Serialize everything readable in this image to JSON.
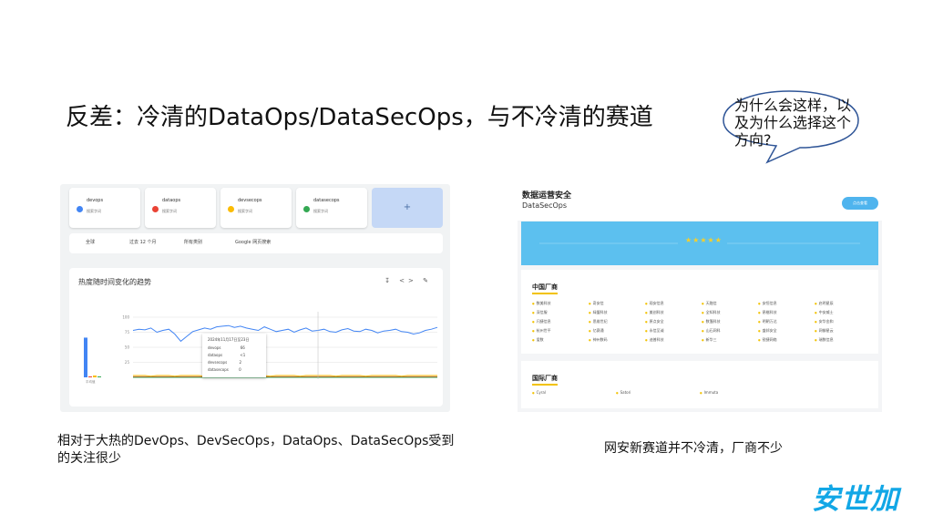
{
  "slide": {
    "title": "反差：冷清的DataOps/DataSecOps，与不冷清的赛道",
    "bubble_text": "为什么会这样，以及为什么选择这个方向?",
    "caption_left": "相对于大热的DevOps、DevSecOps，DataOps、DataSecOps受到的关注很少",
    "caption_right": "网安新赛道并不冷清，厂商不少",
    "logo": "安世加"
  },
  "colors": {
    "accent": "#12a7e6",
    "series_devops": "#4285f4",
    "series_dataops": "#ea4335",
    "series_devsecops": "#fbbc04",
    "series_datasecops": "#34a853"
  },
  "trends": {
    "terms": [
      {
        "name": "devops",
        "sub": "搜索字词"
      },
      {
        "name": "dataops",
        "sub": "搜索字词"
      },
      {
        "name": "devsecops",
        "sub": "搜索字词"
      },
      {
        "name": "datasecops",
        "sub": "搜索字词"
      }
    ],
    "add_label": "+",
    "filters": [
      "全球",
      "过去 12 个月",
      "所有类别",
      "Google 网页搜索"
    ],
    "chart_title": "热度随时间变化的趋势",
    "tooltip_date": "2024年11月17日至23日",
    "tooltip_rows": [
      {
        "term": "devops",
        "value": "66"
      },
      {
        "term": "dataops",
        "value": "<1"
      },
      {
        "term": "devsecops",
        "value": "2"
      },
      {
        "term": "datasecops",
        "value": "0"
      }
    ],
    "avg_label": "平均值"
  },
  "vendor": {
    "title": "数据运营安全",
    "subtitle": "DataSecOps",
    "button": "点击查看",
    "stars": "★★★★★",
    "china_title": "中国厂商",
    "china_vendors": [
      "数美科技",
      "奇安信",
      "观安信息",
      "天融信",
      "安恒信息",
      "启明星辰",
      "深信服",
      "绿盟科技",
      "美创科技",
      "全知科技",
      "昂楷科技",
      "中安威士",
      "闪捷信息",
      "思维世纪",
      "原点安全",
      "数篷科技",
      "明朝万达",
      "安华金和",
      "杭州世平",
      "亿赛通",
      "永信至诚",
      "山石网科",
      "盛邦安全",
      "网御星云",
      "爱数",
      "神州数码",
      "迪普科技",
      "新华三",
      "锐捷网络",
      "瑞数信息"
    ],
    "intl_title": "国际厂商",
    "intl_vendors": [
      "Cyral",
      "Satori",
      "Immuta"
    ]
  },
  "chart_data": {
    "type": "line",
    "x_points": 52,
    "series": [
      {
        "name": "devops",
        "values": [
          78,
          80,
          79,
          82,
          75,
          78,
          80,
          72,
          60,
          68,
          76,
          79,
          82,
          80,
          84,
          85,
          86,
          83,
          85,
          82,
          80,
          78,
          84,
          80,
          76,
          78,
          80,
          75,
          79,
          82,
          77,
          78,
          80,
          76,
          75,
          79,
          81,
          77,
          76,
          80,
          78,
          74,
          77,
          78,
          80,
          76,
          75,
          72,
          74,
          78,
          80,
          83
        ]
      },
      {
        "name": "dataops",
        "values": [
          1,
          1,
          1,
          1,
          1,
          1,
          1,
          1,
          1,
          1,
          1,
          1,
          1,
          1,
          1,
          1,
          1,
          1,
          1,
          1,
          1,
          1,
          1,
          1,
          1,
          1,
          1,
          1,
          1,
          1,
          1,
          1,
          1,
          1,
          1,
          1,
          1,
          1,
          1,
          1,
          1,
          1,
          1,
          1,
          1,
          1,
          1,
          1,
          1,
          1,
          1,
          1
        ]
      },
      {
        "name": "devsecops",
        "values": [
          3,
          3,
          3,
          2,
          3,
          3,
          3,
          2,
          3,
          3,
          3,
          3,
          2,
          3,
          3,
          3,
          3,
          2,
          3,
          3,
          3,
          3,
          3,
          2,
          3,
          3,
          3,
          3,
          2,
          3,
          3,
          3,
          3,
          3,
          2,
          3,
          3,
          3,
          3,
          2,
          3,
          3,
          3,
          3,
          3,
          2,
          3,
          3,
          3,
          3,
          3,
          3
        ]
      },
      {
        "name": "datasecops",
        "values": [
          0,
          0,
          0,
          0,
          0,
          0,
          0,
          0,
          0,
          0,
          0,
          0,
          0,
          0,
          0,
          0,
          0,
          0,
          0,
          0,
          0,
          0,
          0,
          0,
          0,
          0,
          0,
          0,
          0,
          0,
          0,
          0,
          0,
          0,
          0,
          0,
          0,
          0,
          0,
          0,
          0,
          0,
          0,
          0,
          0,
          0,
          0,
          0,
          0,
          0,
          0,
          0
        ]
      }
    ],
    "averages": [
      66,
      1,
      3,
      0
    ],
    "ylim": [
      0,
      100
    ],
    "yticks": [
      100,
      75,
      50,
      25
    ],
    "xlabel": "",
    "ylabel": ""
  }
}
